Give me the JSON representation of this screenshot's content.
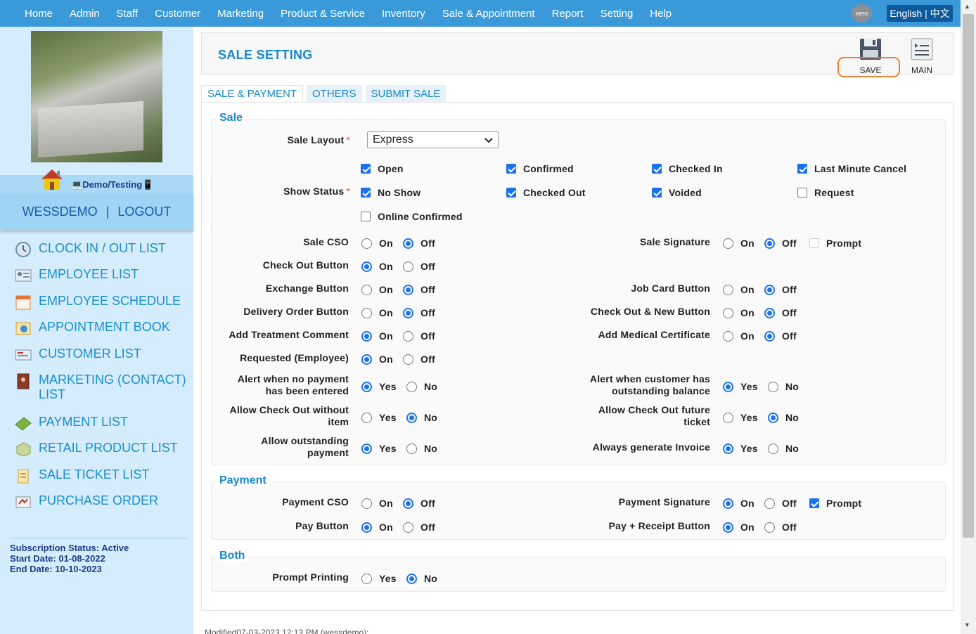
{
  "nav": {
    "items": [
      "Home",
      "Admin",
      "Staff",
      "Customer",
      "Marketing",
      "Product & Service",
      "Inventory",
      "Sale & Appointment",
      "Report",
      "Setting",
      "Help"
    ],
    "xero_label": "xero",
    "language": "English | 中文"
  },
  "sidebar": {
    "demo_label": "Demo/Testing",
    "username": "WESSDEMO",
    "separator": "|",
    "logout": "LOGOUT",
    "menu": [
      {
        "label": "CLOCK IN / OUT LIST",
        "icon": "clock-icon"
      },
      {
        "label": "EMPLOYEE LIST",
        "icon": "employee-icon"
      },
      {
        "label": "EMPLOYEE SCHEDULE",
        "icon": "calendar-icon"
      },
      {
        "label": "APPOINTMENT BOOK",
        "icon": "appointment-icon"
      },
      {
        "label": "CUSTOMER LIST",
        "icon": "customer-icon"
      },
      {
        "label": "MARKETING (CONTACT) LIST",
        "icon": "contact-book-icon"
      },
      {
        "label": "PAYMENT LIST",
        "icon": "money-icon"
      },
      {
        "label": "RETAIL PRODUCT LIST",
        "icon": "box-icon"
      },
      {
        "label": "SALE TICKET LIST",
        "icon": "ticket-icon"
      },
      {
        "label": "PURCHASE ORDER",
        "icon": "purchase-order-icon"
      }
    ],
    "subscription": {
      "status": "Subscription Status: Active",
      "start": "Start Date: 01-08-2022",
      "end": "End Date: 10-10-2023"
    }
  },
  "header": {
    "title": "SALE SETTING",
    "save_label": "SAVE",
    "main_label": "MAIN"
  },
  "tabs": [
    "SALE & PAYMENT",
    "OTHERS",
    "SUBMIT SALE"
  ],
  "sale": {
    "title": "Sale",
    "layout_label": "Sale Layout",
    "layout_value": "Express",
    "show_status_label": "Show Status",
    "statuses": [
      {
        "label": "Open",
        "checked": true
      },
      {
        "label": "Confirmed",
        "checked": true
      },
      {
        "label": "Checked In",
        "checked": true
      },
      {
        "label": "Last Minute Cancel",
        "checked": true
      },
      {
        "label": "No Show",
        "checked": true
      },
      {
        "label": "Checked Out",
        "checked": true
      },
      {
        "label": "Voided",
        "checked": true
      },
      {
        "label": "Request",
        "checked": false
      },
      {
        "label": "Online Confirmed",
        "checked": false
      }
    ],
    "left_settings": [
      {
        "label": "Sale CSO",
        "options": [
          "On",
          "Off"
        ],
        "selected": "Off"
      },
      {
        "label": "Check Out Button",
        "options": [
          "On",
          "Off"
        ],
        "selected": "On"
      },
      {
        "label": "Exchange Button",
        "options": [
          "On",
          "Off"
        ],
        "selected": "Off"
      },
      {
        "label": "Delivery Order Button",
        "options": [
          "On",
          "Off"
        ],
        "selected": "Off"
      },
      {
        "label": "Add Treatment Comment",
        "options": [
          "On",
          "Off"
        ],
        "selected": "On"
      },
      {
        "label": "Requested (Employee)",
        "options": [
          "On",
          "Off"
        ],
        "selected": "On"
      },
      {
        "label": "Alert when no payment has been entered",
        "options": [
          "Yes",
          "No"
        ],
        "selected": "Yes"
      },
      {
        "label": "Allow Check Out without item",
        "options": [
          "Yes",
          "No"
        ],
        "selected": "No"
      },
      {
        "label": "Allow outstanding payment",
        "options": [
          "Yes",
          "No"
        ],
        "selected": "Yes"
      }
    ],
    "right_settings": [
      {
        "label": "Sale Signature",
        "options": [
          "On",
          "Off"
        ],
        "selected": "Off",
        "prompt": "Prompt",
        "prompt_checked": false
      },
      {
        "label": "Job Card Button",
        "options": [
          "On",
          "Off"
        ],
        "selected": "Off"
      },
      {
        "label": "Check Out & New Button",
        "options": [
          "On",
          "Off"
        ],
        "selected": "Off"
      },
      {
        "label": "Add Medical Certificate",
        "options": [
          "On",
          "Off"
        ],
        "selected": "Off"
      },
      {
        "label": "Alert when customer has outstanding balance",
        "options": [
          "Yes",
          "No"
        ],
        "selected": "Yes"
      },
      {
        "label": "Allow Check Out future ticket",
        "options": [
          "Yes",
          "No"
        ],
        "selected": "No"
      },
      {
        "label": "Always generate Invoice",
        "options": [
          "Yes",
          "No"
        ],
        "selected": "Yes"
      }
    ]
  },
  "payment": {
    "title": "Payment",
    "left_settings": [
      {
        "label": "Payment CSO",
        "options": [
          "On",
          "Off"
        ],
        "selected": "Off"
      },
      {
        "label": "Pay Button",
        "options": [
          "On",
          "Off"
        ],
        "selected": "On"
      }
    ],
    "right_settings": [
      {
        "label": "Payment Signature",
        "options": [
          "On",
          "Off"
        ],
        "selected": "On",
        "prompt": "Prompt",
        "prompt_checked": true
      },
      {
        "label": "Pay + Receipt Button",
        "options": [
          "On",
          "Off"
        ],
        "selected": "On"
      }
    ]
  },
  "both": {
    "title": "Both",
    "settings": [
      {
        "label": "Prompt Printing",
        "options": [
          "Yes",
          "No"
        ],
        "selected": "No"
      }
    ]
  },
  "footer": {
    "modified": "Modified07-03-2023 12:13 PM (wessdemo):"
  },
  "colors": {
    "nav_bg": "#3a9ad9",
    "accent": "#1a87c9",
    "radio_checked": "#1a73e8",
    "save_highlight": "#f07d3a"
  }
}
